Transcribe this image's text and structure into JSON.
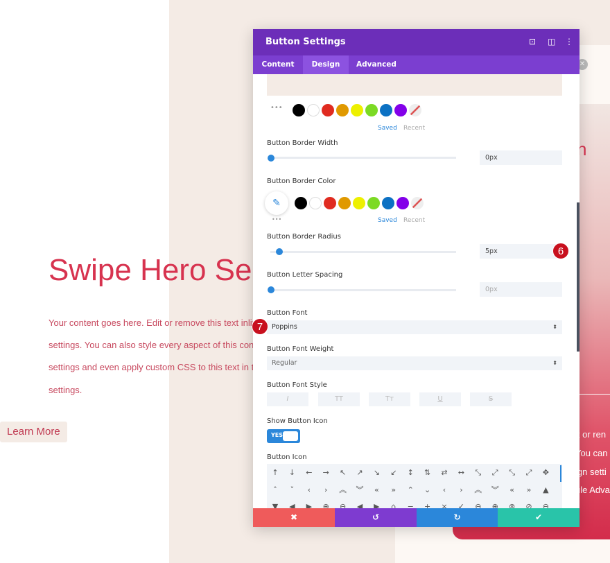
{
  "page": {
    "hero_title": "Swipe Hero Se",
    "paragraph_lines": [
      "Your content goes here. Edit or remove this text inline",
      "settings. You can also style every aspect of this content",
      "settings and even apply custom CSS to this text in the",
      "settings."
    ],
    "button_label": "Learn More",
    "card_partial_title": "n",
    "card_partial_lines": [
      "it or ren",
      "You can",
      "ign setti",
      "ule Adva"
    ]
  },
  "modal": {
    "title": "Button Settings",
    "header_icons": [
      "focus-icon",
      "split-view-icon",
      "more-vertical-icon"
    ],
    "tabs": [
      {
        "label": "Content"
      },
      {
        "label": "Design",
        "active": true
      },
      {
        "label": "Advanced"
      }
    ],
    "palette_colors": [
      "#000000",
      "#ffffff",
      "#e02b20",
      "#e09900",
      "#edf000",
      "#7cda24",
      "#0c71c3",
      "#8300e9"
    ],
    "palette_saved": "Saved",
    "palette_recent": "Recent",
    "border_width": {
      "label": "Button Border Width",
      "value": "0px",
      "slider_percent": 0
    },
    "border_color": {
      "label": "Button Border Color"
    },
    "border_radius": {
      "label": "Button Border Radius",
      "value": "5px",
      "slider_percent": 5
    },
    "letter_spacing": {
      "label": "Button Letter Spacing",
      "value": "0px",
      "slider_percent": 0
    },
    "font": {
      "label": "Button Font",
      "value": "Poppins"
    },
    "font_weight": {
      "label": "Button Font Weight",
      "value": "Regular"
    },
    "font_style": {
      "label": "Button Font Style",
      "options": [
        "I",
        "TT",
        "Tт",
        "U",
        "S"
      ]
    },
    "show_icon": {
      "label": "Show Button Icon",
      "value": "YES"
    },
    "button_icon": {
      "label": "Button Icon",
      "rows": [
        [
          "↑",
          "↓",
          "←",
          "→",
          "↖",
          "↗",
          "↘",
          "↙",
          "↕",
          "⇅",
          "⇄",
          "↔",
          "⤡",
          "⤢",
          "⤡",
          "⤢",
          "✥"
        ],
        [
          "˄",
          "˅",
          "‹",
          "›",
          "︽",
          "︾",
          "«",
          "»",
          "⌃",
          "⌄",
          "‹",
          "›",
          "︽",
          "︾",
          "«",
          "»",
          "▲"
        ],
        [
          "▼",
          "◀",
          "▶",
          "⊕",
          "⊖",
          "◀",
          "▶",
          "⌂",
          "−",
          "+",
          "×",
          "✓",
          "⊖",
          "⊕",
          "⊗",
          "⊘",
          "⊖"
        ]
      ]
    },
    "footer": {
      "cancel": "✖",
      "undo": "↺",
      "redo": "↻",
      "save": "✔",
      "colors": {
        "cancel": "#ef5b5b",
        "undo": "#7e3bd0",
        "redo": "#2b87da",
        "save": "#29c4a9"
      }
    },
    "annotations": [
      "6",
      "7"
    ]
  }
}
